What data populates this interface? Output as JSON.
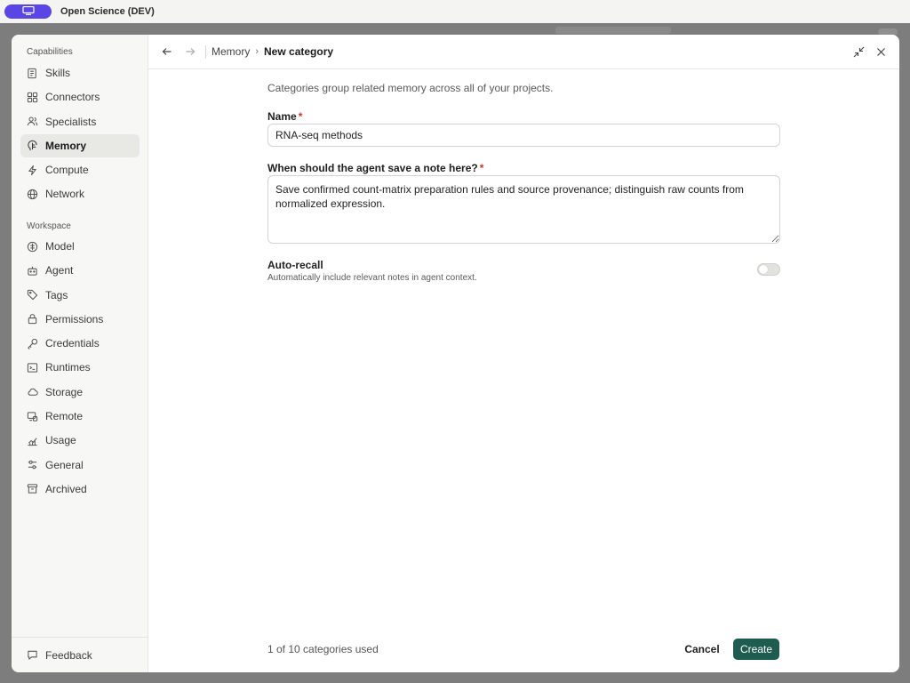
{
  "app": {
    "title": "Open Science (DEV)",
    "accent": "#5a46e4"
  },
  "sidebar": {
    "capabilities_heading": "Capabilities",
    "capabilities": [
      {
        "label": "Skills",
        "icon": "skills-icon"
      },
      {
        "label": "Connectors",
        "icon": "connectors-icon"
      },
      {
        "label": "Specialists",
        "icon": "specialists-icon"
      },
      {
        "label": "Memory",
        "icon": "memory-icon",
        "active": true
      },
      {
        "label": "Compute",
        "icon": "compute-icon"
      },
      {
        "label": "Network",
        "icon": "network-icon"
      }
    ],
    "workspace_heading": "Workspace",
    "workspace": [
      {
        "label": "Model",
        "icon": "model-icon"
      },
      {
        "label": "Agent",
        "icon": "agent-icon"
      },
      {
        "label": "Tags",
        "icon": "tags-icon"
      },
      {
        "label": "Permissions",
        "icon": "lock-icon"
      },
      {
        "label": "Credentials",
        "icon": "key-icon"
      },
      {
        "label": "Runtimes",
        "icon": "terminal-icon"
      },
      {
        "label": "Storage",
        "icon": "cloud-icon"
      },
      {
        "label": "Remote",
        "icon": "remote-icon"
      },
      {
        "label": "Usage",
        "icon": "chart-icon"
      },
      {
        "label": "General",
        "icon": "sliders-icon"
      },
      {
        "label": "Archived",
        "icon": "archive-icon"
      }
    ],
    "feedback_label": "Feedback"
  },
  "header": {
    "breadcrumb_parent": "Memory",
    "breadcrumb_separator": "›",
    "breadcrumb_current": "New category"
  },
  "form": {
    "description": "Categories group related memory across all of your projects.",
    "name_label": "Name",
    "required_marker": "*",
    "name_value": "RNA-seq methods",
    "note_label": "When should the agent save a note here?",
    "note_value": "Save confirmed count-matrix preparation rules and source provenance; distinguish raw counts from normalized expression.",
    "auto_recall_title": "Auto-recall",
    "auto_recall_desc": "Automatically include relevant notes in agent context.",
    "auto_recall_enabled": false
  },
  "footer": {
    "usage_text": "1 of 10 categories used",
    "cancel_label": "Cancel",
    "create_label": "Create",
    "create_color": "#1d5c4f"
  }
}
